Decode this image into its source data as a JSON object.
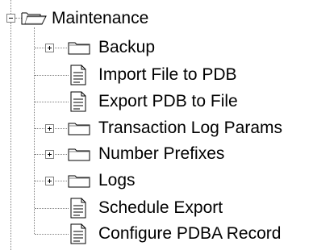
{
  "tree": {
    "root": {
      "label": "Maintenance",
      "expanded": true,
      "icon": "folder-open-icon"
    },
    "children": [
      {
        "label": "Backup",
        "type": "folder",
        "expandable": true,
        "icon": "folder-icon"
      },
      {
        "label": "Import File to PDB",
        "type": "document",
        "expandable": false,
        "icon": "document-icon"
      },
      {
        "label": "Export PDB to File",
        "type": "document",
        "expandable": false,
        "icon": "document-icon"
      },
      {
        "label": "Transaction Log Params",
        "type": "folder",
        "expandable": true,
        "icon": "folder-icon"
      },
      {
        "label": "Number Prefixes",
        "type": "folder",
        "expandable": true,
        "icon": "folder-icon"
      },
      {
        "label": "Logs",
        "type": "folder",
        "expandable": true,
        "icon": "folder-icon"
      },
      {
        "label": "Schedule Export",
        "type": "document",
        "expandable": false,
        "icon": "document-icon"
      },
      {
        "label": "Configure PDBA Record",
        "type": "document",
        "expandable": false,
        "icon": "document-icon"
      }
    ]
  },
  "colors": {
    "background": "#ffffff",
    "connector": "#808080",
    "folder_fill": "#ffffff",
    "folder_outline": "#000000",
    "text": "#000000"
  }
}
